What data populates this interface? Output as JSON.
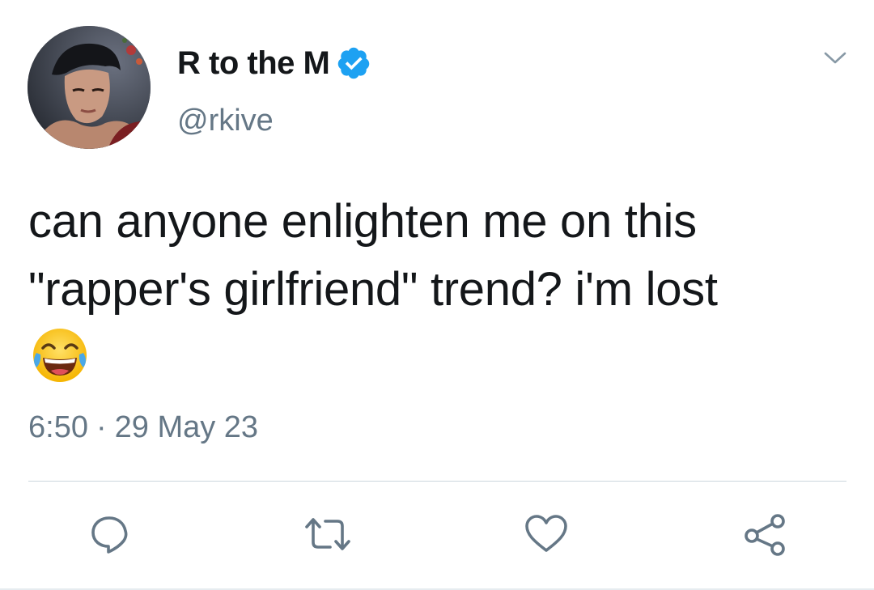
{
  "user": {
    "display_name": "R to the M",
    "handle": "@rkive",
    "verified": true
  },
  "tweet": {
    "text_lines": [
      "can anyone enlighten me on this",
      "\"rapper's girlfriend\" trend? i'm lost"
    ],
    "emoji": "face-with-tears-of-joy",
    "time": "6:50",
    "separator": "·",
    "date": "29 May 23"
  },
  "actions": [
    {
      "name": "reply",
      "icon": "reply-icon"
    },
    {
      "name": "retweet",
      "icon": "retweet-icon"
    },
    {
      "name": "like",
      "icon": "heart-icon"
    },
    {
      "name": "share",
      "icon": "share-icon"
    }
  ],
  "colors": {
    "text": "#14171a",
    "secondary": "#657786",
    "verified_blue": "#1da1f2",
    "divider": "#ccd6dd"
  }
}
